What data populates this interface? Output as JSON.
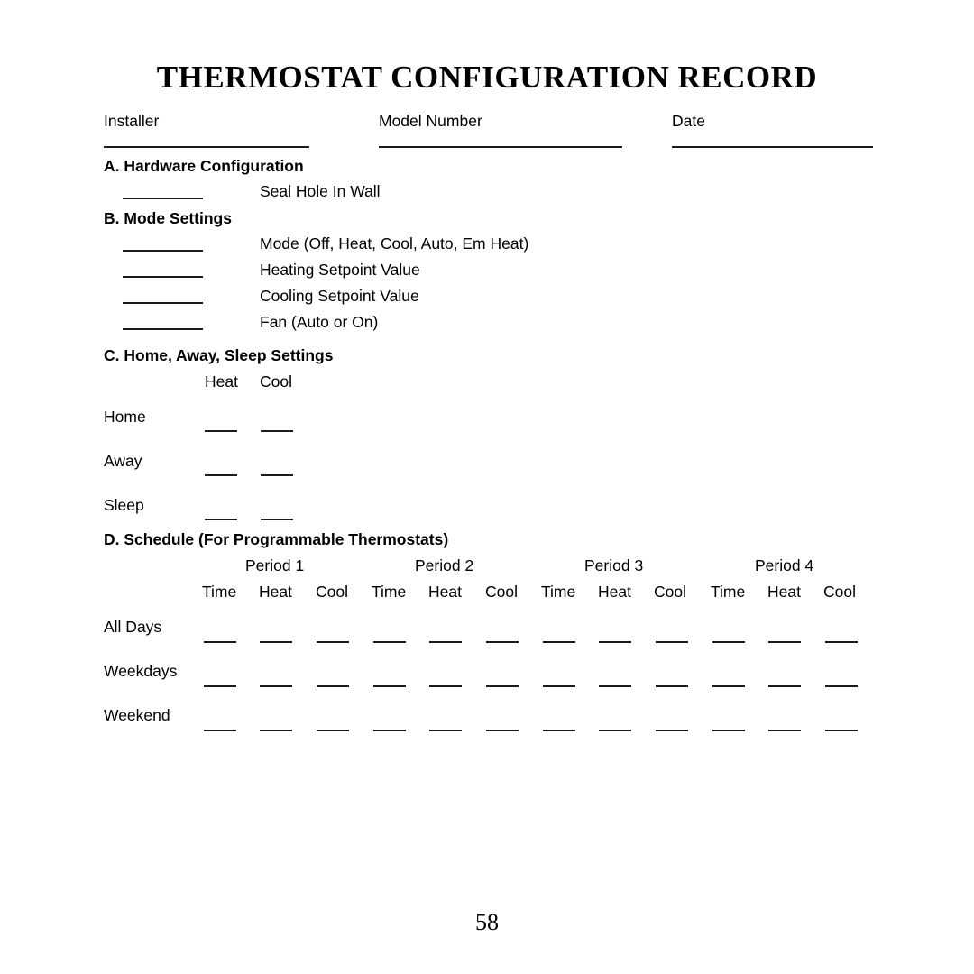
{
  "document": {
    "title": "THERMOSTAT CONFIGURATION RECORD",
    "page_number": "58"
  },
  "header_fields": [
    {
      "label": "Installer",
      "value": ""
    },
    {
      "label": "Model Number",
      "value": ""
    },
    {
      "label": "Date",
      "value": ""
    }
  ],
  "sections": {
    "a": {
      "heading": "A. Hardware Configuration",
      "items": [
        {
          "label": "Seal Hole In Wall",
          "value": ""
        }
      ]
    },
    "b": {
      "heading": "B. Mode Settings",
      "items": [
        {
          "label": "Mode (Off, Heat, Cool, Auto, Em Heat)",
          "value": ""
        },
        {
          "label": "Heating Setpoint Value",
          "value": ""
        },
        {
          "label": "Cooling Setpoint Value",
          "value": ""
        },
        {
          "label": "Fan (Auto or On)",
          "value": ""
        }
      ]
    },
    "c": {
      "heading": "C. Home, Away, Sleep Settings",
      "columns": [
        "Heat",
        "Cool"
      ],
      "rows": [
        {
          "label": "Home",
          "values": [
            "",
            ""
          ]
        },
        {
          "label": "Away",
          "values": [
            "",
            ""
          ]
        },
        {
          "label": "Sleep",
          "values": [
            "",
            ""
          ]
        }
      ]
    },
    "d": {
      "heading": "D. Schedule (For Programmable Thermostats)",
      "periods": [
        "Period 1",
        "Period 2",
        "Period 3",
        "Period 4"
      ],
      "columns": [
        "Time",
        "Heat",
        "Cool",
        "Time",
        "Heat",
        "Cool",
        "Time",
        "Heat",
        "Cool",
        "Time",
        "Heat",
        "Cool"
      ],
      "rows": [
        {
          "label": "All Days",
          "values": [
            "",
            "",
            "",
            "",
            "",
            "",
            "",
            "",
            "",
            "",
            "",
            ""
          ]
        },
        {
          "label": "Weekdays",
          "values": [
            "",
            "",
            "",
            "",
            "",
            "",
            "",
            "",
            "",
            "",
            "",
            ""
          ]
        },
        {
          "label": "Weekend",
          "values": [
            "",
            "",
            "",
            "",
            "",
            "",
            "",
            "",
            "",
            "",
            "",
            ""
          ]
        }
      ]
    }
  }
}
